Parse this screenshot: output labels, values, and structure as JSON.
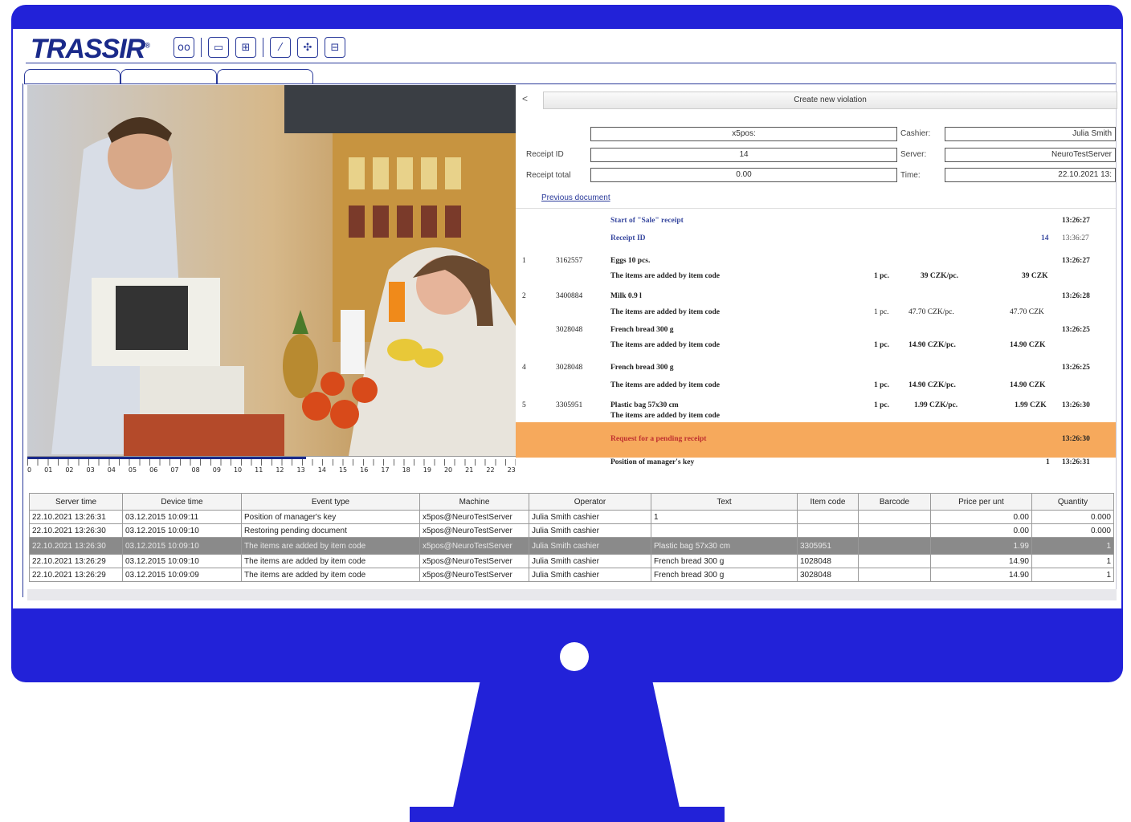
{
  "app": {
    "logo_text": "TRASSIR",
    "logo_reg": "®"
  },
  "toolbar": {
    "icons": [
      "video-icon",
      "monitor-icon",
      "pos-icon",
      "wand-icon",
      "puzzle-icon",
      "settings-screen-icon"
    ]
  },
  "colors": {
    "monitor_frame": "#2222d8",
    "brand": "#1a2a8a",
    "highlight": "#f6a95c",
    "selected_row": "#8a8a8a"
  },
  "tabs": [
    "",
    "",
    ""
  ],
  "timeline": {
    "labels": [
      "0",
      "01",
      "02",
      "03",
      "04",
      "05",
      "06",
      "07",
      "08",
      "09",
      "10",
      "11",
      "12",
      "13",
      "14",
      "15",
      "16",
      "17",
      "18",
      "19",
      "20",
      "21",
      "22",
      "23"
    ],
    "progress": 0.57
  },
  "violation": {
    "back_symbol": "<",
    "create_button": "Create new violation",
    "pos_field": "x5pos:",
    "receipt_id_label": "Receipt ID",
    "receipt_id": "14",
    "receipt_total_label": "Receipt total",
    "receipt_total": "0.00",
    "cashier_label": "Cashier:",
    "cashier": "Julia Smith",
    "server_label": "Server:",
    "server": "NeuroTestServer",
    "time_label": "Time:",
    "time": "22.10.2021 13:",
    "previous_document": "Previous document"
  },
  "receipt": {
    "start_title": "Start of \"Sale\" receipt",
    "start_time": "13:26:27",
    "receipt_id_label": "Receipt ID",
    "receipt_id_value": "14",
    "receipt_id_time": "13:36:27",
    "items": [
      {
        "num": "1",
        "code": "3162557",
        "name": "Eggs 10 pcs.",
        "time": "13:26:27",
        "note": "The items are added by item code",
        "qty": "1 pc.",
        "price": "39 CZK/pc.",
        "total": "39 CZK"
      },
      {
        "num": "2",
        "code": "3400884",
        "name": "Milk 0.9 l",
        "time": "13:26:28",
        "note": "The items are added by item code",
        "qty": "1 pc.",
        "price": "47.70 CZK/pc.",
        "total": "47.70 CZK"
      },
      {
        "num": "",
        "code": "3028048",
        "name": "French bread 300 g",
        "time": "13:26:25",
        "note": "The items are added by item code",
        "qty": "1 pc.",
        "price": "14.90 CZK/pc.",
        "total": "14.90 CZK"
      },
      {
        "num": "4",
        "code": "3028048",
        "name": "French bread 300 g",
        "time": "13:26:25",
        "note": "The items are added by item code",
        "qty": "1 pc.",
        "price": "14.90 CZK/pc.",
        "total": "14.90 CZK"
      },
      {
        "num": "5",
        "code": "3305951",
        "name": "Plastic bag 57x30 cm",
        "time": "13:26:30",
        "note": "The items are added by item code",
        "qty": "1 pc.",
        "price": "1.99 CZK/pc.",
        "total": "1.99 CZK"
      }
    ],
    "pending_request": "Request for a pending receipt",
    "pending_time": "13:26:30",
    "manager_key": "Position of manager's key",
    "manager_value": "1",
    "manager_time": "13:26:31"
  },
  "events": {
    "headers": [
      "Server time",
      "Device time",
      "Event type",
      "Machine",
      "Operator",
      "Text",
      "Item code",
      "Barcode",
      "Price per unt",
      "Quantity"
    ],
    "rows": [
      [
        "22.10.2021 13:26:31",
        "03.12.2015 10:09:11",
        "Position of manager's key",
        "x5pos@NeuroTestServer",
        "Julia Smith cashier",
        "1",
        "",
        "",
        "0.00",
        "0.000"
      ],
      [
        "22.10.2021 13:26:30",
        "03.12.2015 10:09:10",
        "Restoring pending document",
        "x5pos@NeuroTestServer",
        "Julia Smith cashier",
        "",
        "",
        "",
        "0.00",
        "0.000"
      ],
      [
        "22.10.2021 13:26:30",
        "03.12.2015 10:09:10",
        "The items are added by item code",
        "x5pos@NeuroTestServer",
        "Julia Smith cashier",
        "Plastic bag 57x30 cm",
        "3305951",
        "",
        "1.99",
        "1"
      ],
      [
        "22.10.2021 13:26:29",
        "03.12.2015 10:09:10",
        "The items are added by item code",
        "x5pos@NeuroTestServer",
        "Julia Smith cashier",
        "French bread 300 g",
        "1028048",
        "",
        "14.90",
        "1"
      ],
      [
        "22.10.2021 13:26:29",
        "03.12.2015 10:09:09",
        "The items are added by item code",
        "x5pos@NeuroTestServer",
        "Julia Smith cashier",
        "French bread 300 g",
        "3028048",
        "",
        "14.90",
        "1"
      ]
    ],
    "selected_index": 2
  }
}
